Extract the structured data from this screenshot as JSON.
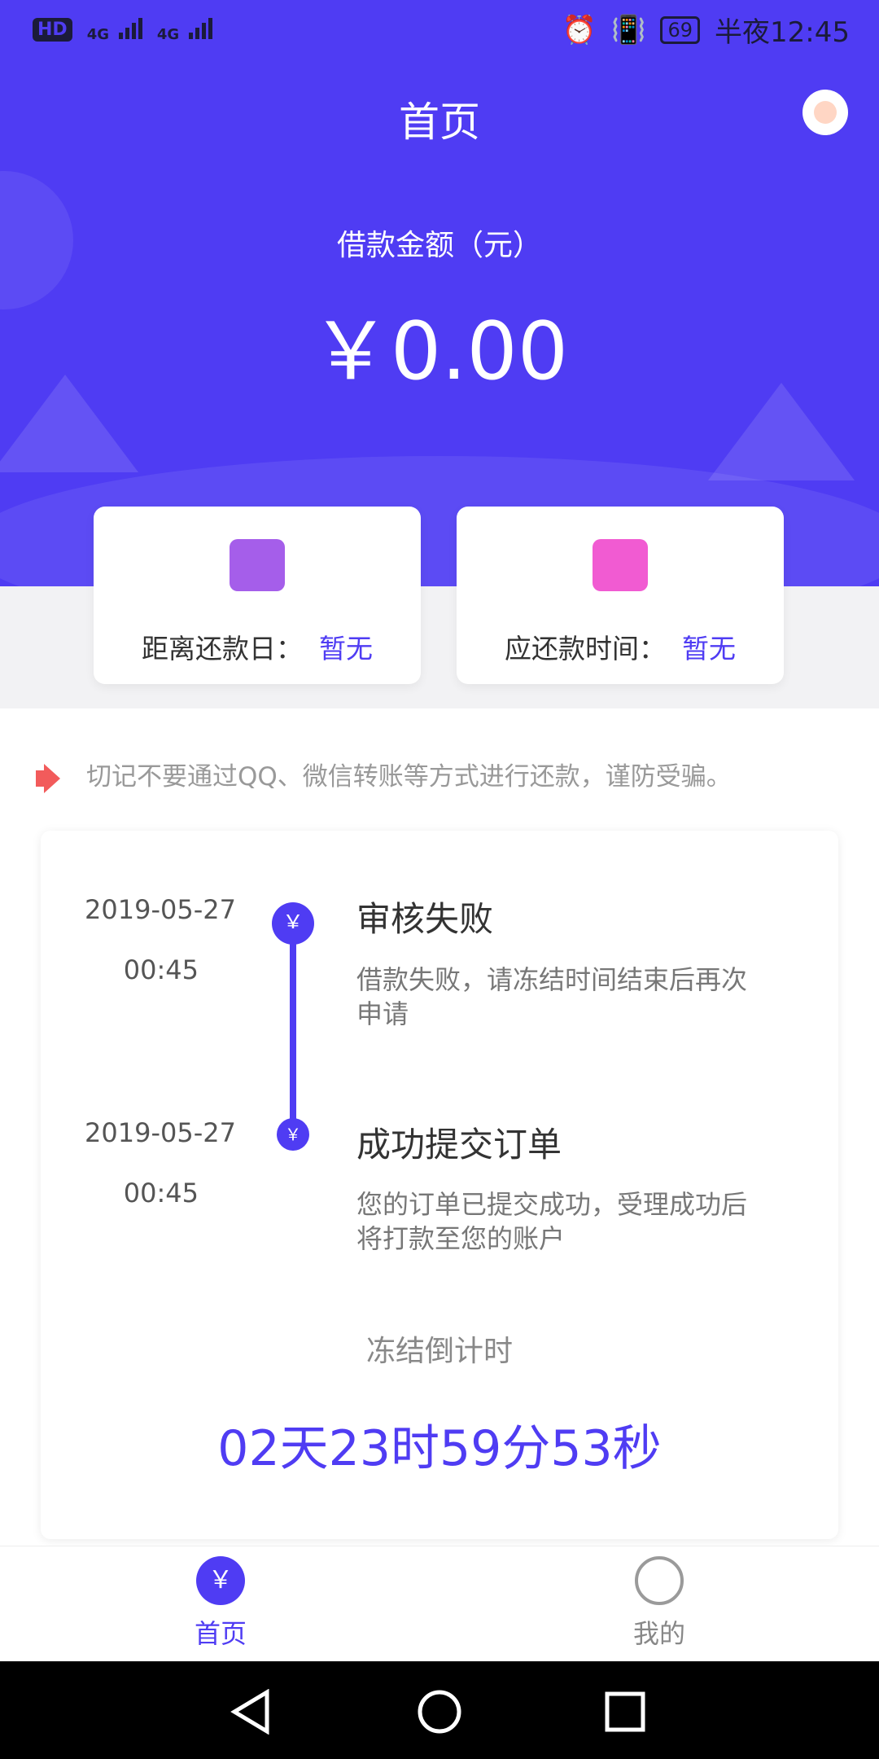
{
  "status_bar": {
    "left": [
      "HD",
      "4G",
      "4G"
    ],
    "battery": "69",
    "time": "半夜12:45"
  },
  "header": {
    "title": "首页",
    "avatar_icon": "user-avatar-icon"
  },
  "loan": {
    "label": "借款金额（元）",
    "amount": "￥0.00"
  },
  "cards": [
    {
      "icon": "calendar-check-icon",
      "label": "距离还款日：",
      "value": "暂无",
      "icon_color": "#a55eea"
    },
    {
      "icon": "calendar-icon",
      "label": "应还款时间：",
      "value": "暂无",
      "icon_color": "#f15bd2"
    }
  ],
  "notice": {
    "icon": "speaker-icon",
    "text": "切记不要通过QQ、微信转账等方式进行还款，谨防受骗。"
  },
  "timeline": [
    {
      "date": "2019-05-27",
      "time": "00:45",
      "title": "审核失败",
      "desc": "借款失败，请冻结时间结束后再次申请",
      "dot": "￥"
    },
    {
      "date": "2019-05-27",
      "time": "00:45",
      "title": "成功提交订单",
      "desc": "您的订单已提交成功，受理成功后将打款至您的账户",
      "dot": "￥"
    }
  ],
  "countdown": {
    "label": "冻结倒计时",
    "value": "02天23时59分53秒"
  },
  "tabs": [
    {
      "label": "首页",
      "icon": "home-yen-icon",
      "active": true
    },
    {
      "label": "我的",
      "icon": "person-icon",
      "active": false
    }
  ],
  "colors": {
    "primary": "#4f3cf3",
    "accent_text": "#4f3cf3"
  }
}
